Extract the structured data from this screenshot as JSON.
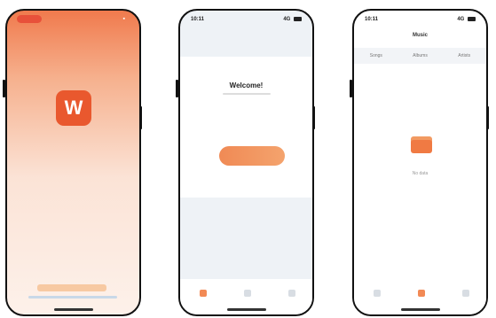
{
  "phones": [
    {
      "logo_letter": "W",
      "start_button_label": "",
      "status_time": ""
    },
    {
      "status_time": "10:11",
      "status_right": "4G",
      "welcome_title": "Welcome!",
      "cta_label": ""
    },
    {
      "status_time": "10:11",
      "status_right": "4G",
      "header_title": "Music",
      "segments": [
        "Songs",
        "Albums",
        "Artists"
      ],
      "empty_text": "No data"
    }
  ],
  "colors": {
    "accent": "#F07A4D",
    "cta": "#F08A55"
  },
  "icons": {
    "tab_home": "home-icon",
    "tab_discover": "discover-icon",
    "tab_profile": "profile-icon",
    "empty_state": "folder-icon"
  }
}
